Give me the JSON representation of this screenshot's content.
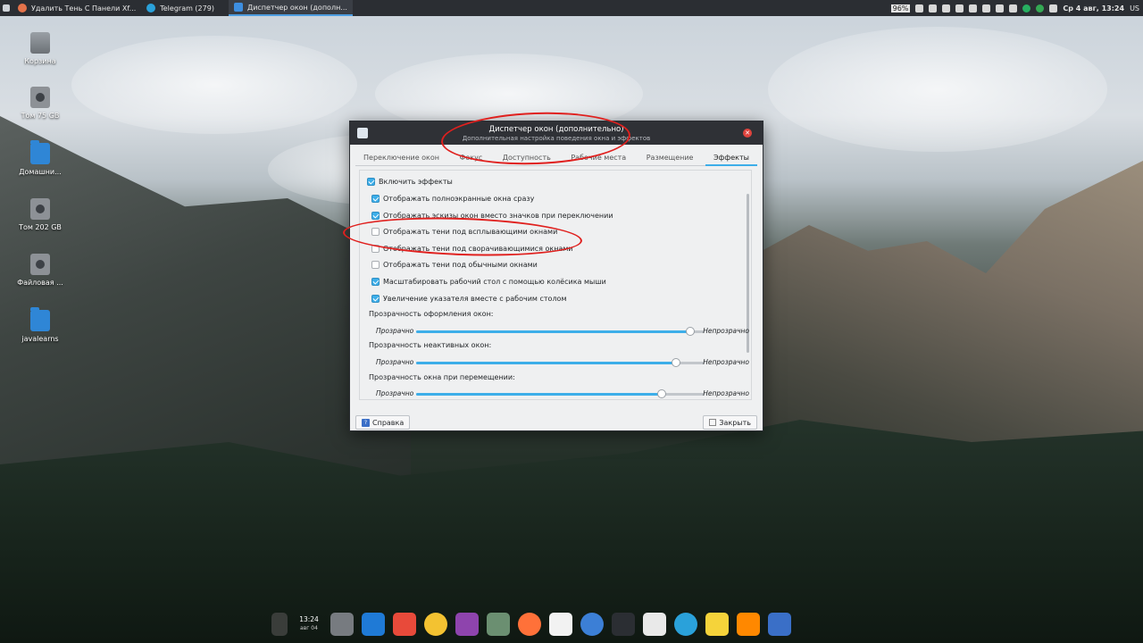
{
  "top_panel": {
    "tasks": [
      {
        "label": "Удалить Тень С Панели Xf...",
        "icon_color": "#e5734a"
      },
      {
        "label": "Telegram (279)",
        "icon_color": "#2aa1da"
      },
      {
        "label": "Диспетчер окон (дополн...",
        "icon_color": "#3d8ee0"
      }
    ],
    "battery": "96%",
    "clock": "Ср  4 авг, 13:24",
    "layout": "US"
  },
  "desktop_icons": [
    {
      "label": "Корзина",
      "icon": "trash-icon"
    },
    {
      "label": "Том 75 GB",
      "icon": "disk-icon"
    },
    {
      "label": "Домашни...",
      "icon": "home-folder-icon"
    },
    {
      "label": "Том 202 GB",
      "icon": "disk-icon"
    },
    {
      "label": "Файловая ...",
      "icon": "disk-icon"
    },
    {
      "label": "javalearns",
      "icon": "folder-icon"
    }
  ],
  "dialog": {
    "title": "Диспетчер окон (дополнительно)",
    "subtitle": "Дополнительная настройка поведения окна и эффектов",
    "tabs": [
      "Переключение окон",
      "Фокус",
      "Доступность",
      "Рабочие места",
      "Размещение",
      "Эффекты"
    ],
    "active_tab": "Эффекты",
    "enable_effects": "Включить эффекты",
    "options": [
      {
        "label": "Отображать полноэкранные окна сразу",
        "checked": true
      },
      {
        "label": "Отображать эскизы окон вместо значков при переключении",
        "checked": true
      },
      {
        "label": "Отображать тени под всплывающими окнами",
        "checked": false
      },
      {
        "label": "Отображать тени под сворачивающимися окнами",
        "checked": false
      },
      {
        "label": "Отображать тени под обычными окнами",
        "checked": false
      },
      {
        "label": "Масштабировать рабочий стол с помощью колёсика мыши",
        "checked": true
      },
      {
        "label": "Увеличение указателя вместе с рабочим столом",
        "checked": true
      }
    ],
    "sliders": [
      {
        "label": "Прозрачность оформления окон:",
        "low": "Прозрачно",
        "high": "Непрозрачно",
        "value": 0.95
      },
      {
        "label": "Прозрачность неактивных окон:",
        "low": "Прозрачно",
        "high": "Непрозрачно",
        "value": 0.9
      },
      {
        "label": "Прозрачность окна при перемещении:",
        "low": "Прозрачно",
        "high": "Непрозрачно",
        "value": 0.85
      }
    ],
    "help_button": "Справка",
    "close_button": "Закрыть"
  },
  "dock": {
    "time": "13:24",
    "date": "авг 04",
    "items": [
      {
        "name": "battery-monitor-icon",
        "color": "#3a3d3a"
      },
      {
        "name": "trash-icon",
        "color": "#777b80"
      },
      {
        "name": "desktop-icon",
        "color": "#1f7ad6"
      },
      {
        "name": "calendar-icon",
        "color": "#e84a3a"
      },
      {
        "name": "disk-utility-icon",
        "color": "#f3c231"
      },
      {
        "name": "color-picker-icon",
        "color": "#8e44ad"
      },
      {
        "name": "archive-icon",
        "color": "#6b8f71"
      },
      {
        "name": "firefox-icon",
        "color": "#ff7139"
      },
      {
        "name": "software-store-icon",
        "color": "#f2f2f2"
      },
      {
        "name": "weather-icon",
        "color": "#3c7fd6"
      },
      {
        "name": "terminal-icon",
        "color": "#2b2e33"
      },
      {
        "name": "calculator-icon",
        "color": "#e9e9e9"
      },
      {
        "name": "telegram-icon",
        "color": "#2aa1da"
      },
      {
        "name": "notes-icon",
        "color": "#f5d33a"
      },
      {
        "name": "vlc-icon",
        "color": "#ff8800"
      },
      {
        "name": "settings-icon",
        "color": "#3a6fc7"
      }
    ]
  }
}
